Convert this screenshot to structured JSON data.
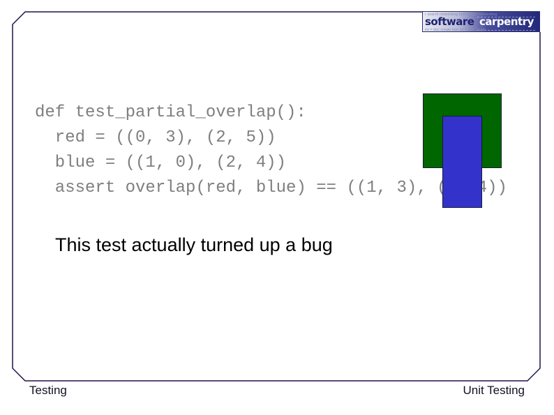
{
  "logo": {
    "word1": "software",
    "word2": "carpentry",
    "tagline_top": "r search networking text search networking",
    "tagline_bottom": "int = doc create test int = doc create"
  },
  "slide": {
    "code_lines": [
      "def test_partial_overlap():",
      "  red = ((0, 3), (2, 5))",
      "  blue = ((1, 0), (2, 4))",
      "  assert overlap(red, blue) == ((1, 3), (2, 4))"
    ],
    "bullet": "This test actually turned up a bug",
    "shapes": {
      "red_rect_color": "#006600",
      "blue_rect_color": "#3333cc"
    }
  },
  "footer": {
    "left": "Testing",
    "right": "Unit Testing"
  },
  "colors": {
    "border": "#22104a",
    "code_text": "#7f7f7f"
  }
}
